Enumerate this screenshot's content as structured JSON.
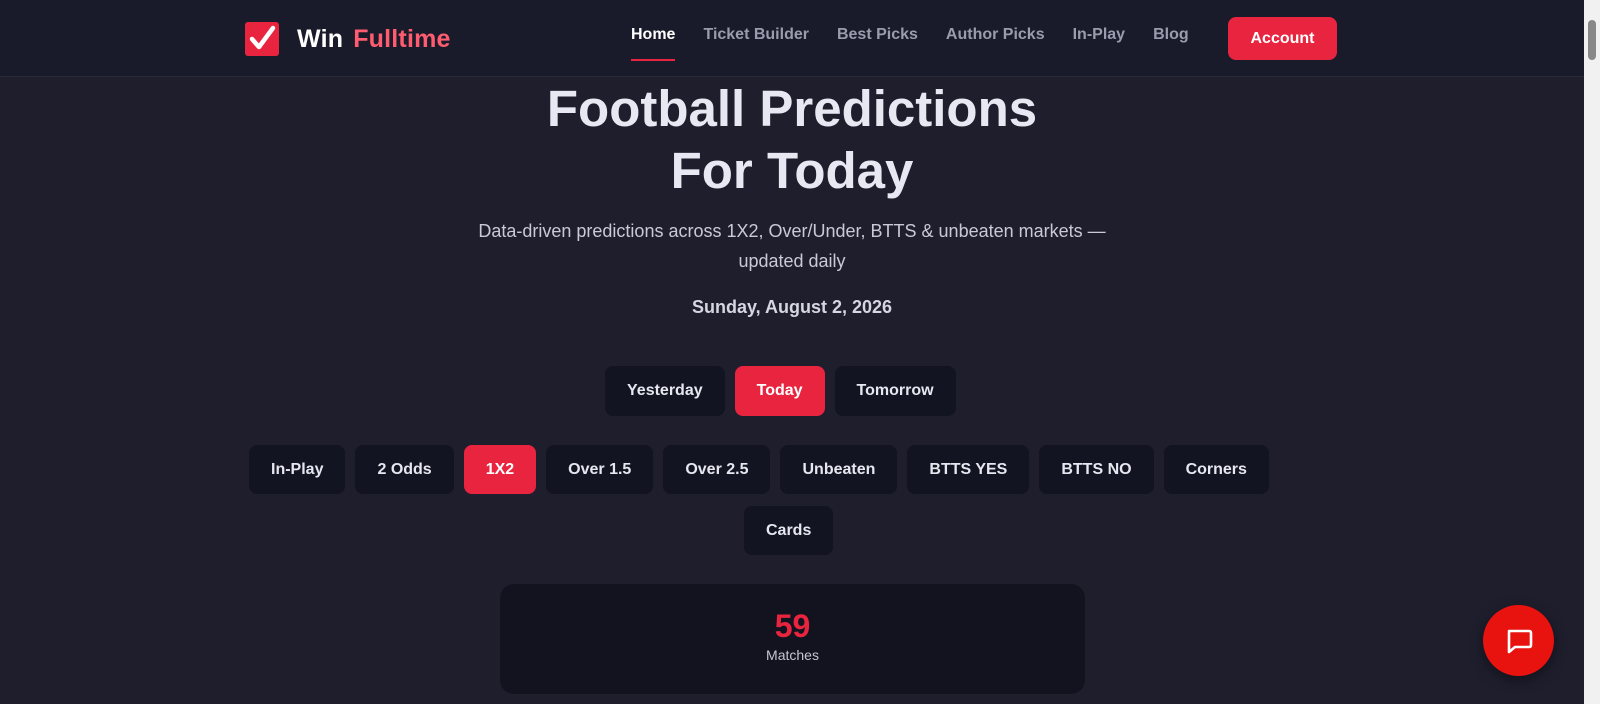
{
  "header": {
    "logo_win": "Win",
    "logo_fulltime": "Fulltime",
    "nav": [
      "Home",
      "Ticket Builder",
      "Best Picks",
      "Author Picks",
      "In-Play",
      "Blog"
    ],
    "account_label": "Account"
  },
  "hero": {
    "title_line1": "Football Predictions",
    "title_line2": "For Today",
    "subtitle_line1": "Data-driven predictions across 1X2, Over/Under, BTTS & unbeaten markets —",
    "subtitle_line2": "updated daily",
    "date": "Sunday, August 2, 2026"
  },
  "day_tabs": [
    "Yesterday",
    "Today",
    "Tomorrow"
  ],
  "market_tabs": [
    "In-Play",
    "2 Odds",
    "1X2",
    "Over 1.5",
    "Over 2.5",
    "Unbeaten",
    "BTTS YES",
    "BTTS NO",
    "Corners",
    "Cards"
  ],
  "stat": {
    "value": "59",
    "label": "Matches"
  },
  "colors": {
    "accent": "#e8243f",
    "background": "#1e1e2d",
    "card": "#12131f"
  }
}
